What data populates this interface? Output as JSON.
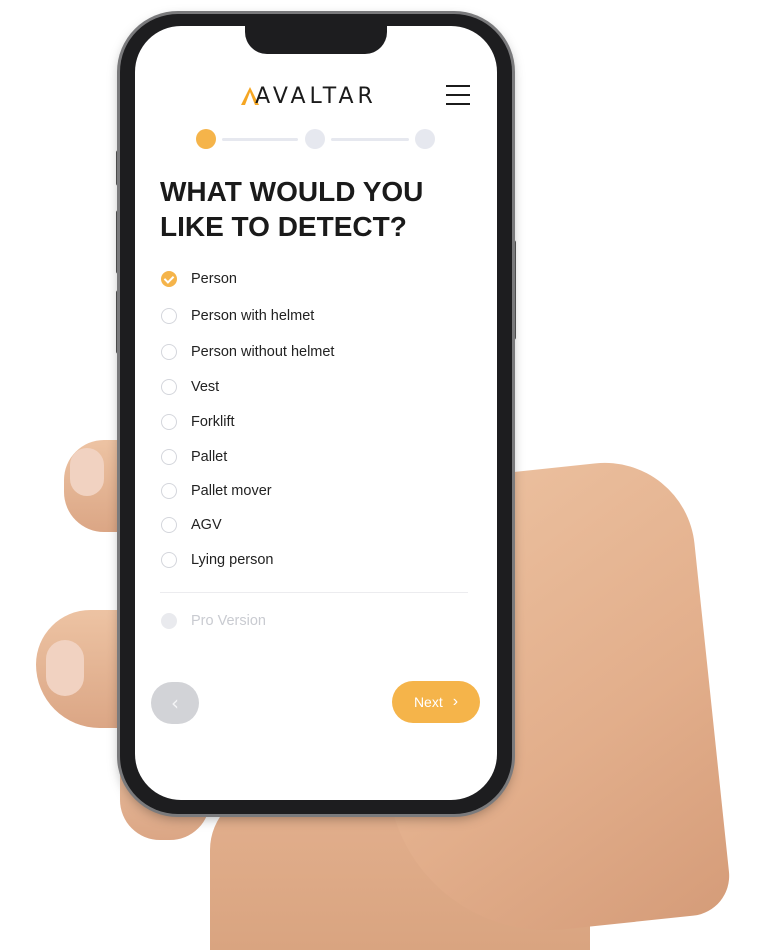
{
  "app": {
    "logo_text": "AVALTAR",
    "menu_icon": "hamburger-icon",
    "accent_color": "#f5b44a"
  },
  "stepper": {
    "steps": 3,
    "current_step": 1
  },
  "question": {
    "line1": "WHAT WOULD YOU",
    "line2": "LIKE TO DETECT?"
  },
  "options": [
    {
      "label": "Person",
      "checked": true
    },
    {
      "label": "Person with helmet",
      "checked": false
    },
    {
      "label": "Person without  helmet",
      "checked": false
    },
    {
      "label": "Vest",
      "checked": false
    },
    {
      "label": "Forklift",
      "checked": false
    },
    {
      "label": "Pallet",
      "checked": false
    },
    {
      "label": "Pallet mover",
      "checked": false
    },
    {
      "label": "AGV",
      "checked": false
    },
    {
      "label": "Lying person",
      "checked": false
    }
  ],
  "pro_option": {
    "label": "Pro Version",
    "disabled": true
  },
  "nav": {
    "back_icon": "chevron-left-icon",
    "next_label": "Next",
    "next_icon": "chevron-right-icon"
  }
}
